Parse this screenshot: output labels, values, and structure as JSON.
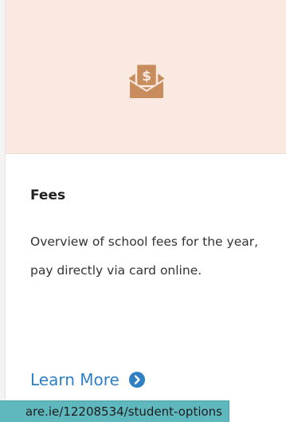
{
  "card": {
    "icon": "envelope-dollar-icon",
    "title": "Fees",
    "description": "Overview of school fees for the year, pay directly via card online.",
    "link_label": "Learn More",
    "link_icon": "chevron-right-circle-icon",
    "colors": {
      "hero_bg": "#f9e9e0",
      "icon": "#c98c5c",
      "link": "#2f7fc4"
    }
  },
  "status_bar": {
    "url_text": "are.ie/12208534/student-options",
    "bg_color": "#60b8bf"
  }
}
